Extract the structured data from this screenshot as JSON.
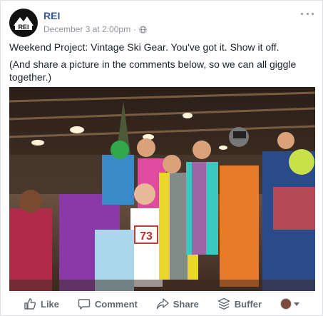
{
  "post": {
    "page_name": "REI",
    "timestamp": "December 3 at 2:00pm",
    "separator": "·",
    "logo_text": "REI",
    "line1": "Weekend Project: Vintage Ski Gear. You've got it. Show it off.",
    "line2": "(And share a picture in the comments below, so we can all giggle together.)"
  },
  "photo": {
    "bib_number": "73",
    "description_alt": "Group of people in colorful vintage ski suits posing in an REI store"
  },
  "actions": {
    "like_label": "Like",
    "comment_label": "Comment",
    "share_label": "Share",
    "buffer_label": "Buffer"
  },
  "icons": {
    "more": "more-options-icon",
    "globe": "globe-icon",
    "like": "thumbs-up-icon",
    "comment": "speech-bubble-icon",
    "share": "share-arrow-icon",
    "buffer": "buffer-stack-icon"
  },
  "colors": {
    "link_blue": "#365899",
    "meta_gray": "#90949c",
    "action_gray": "#606770"
  }
}
